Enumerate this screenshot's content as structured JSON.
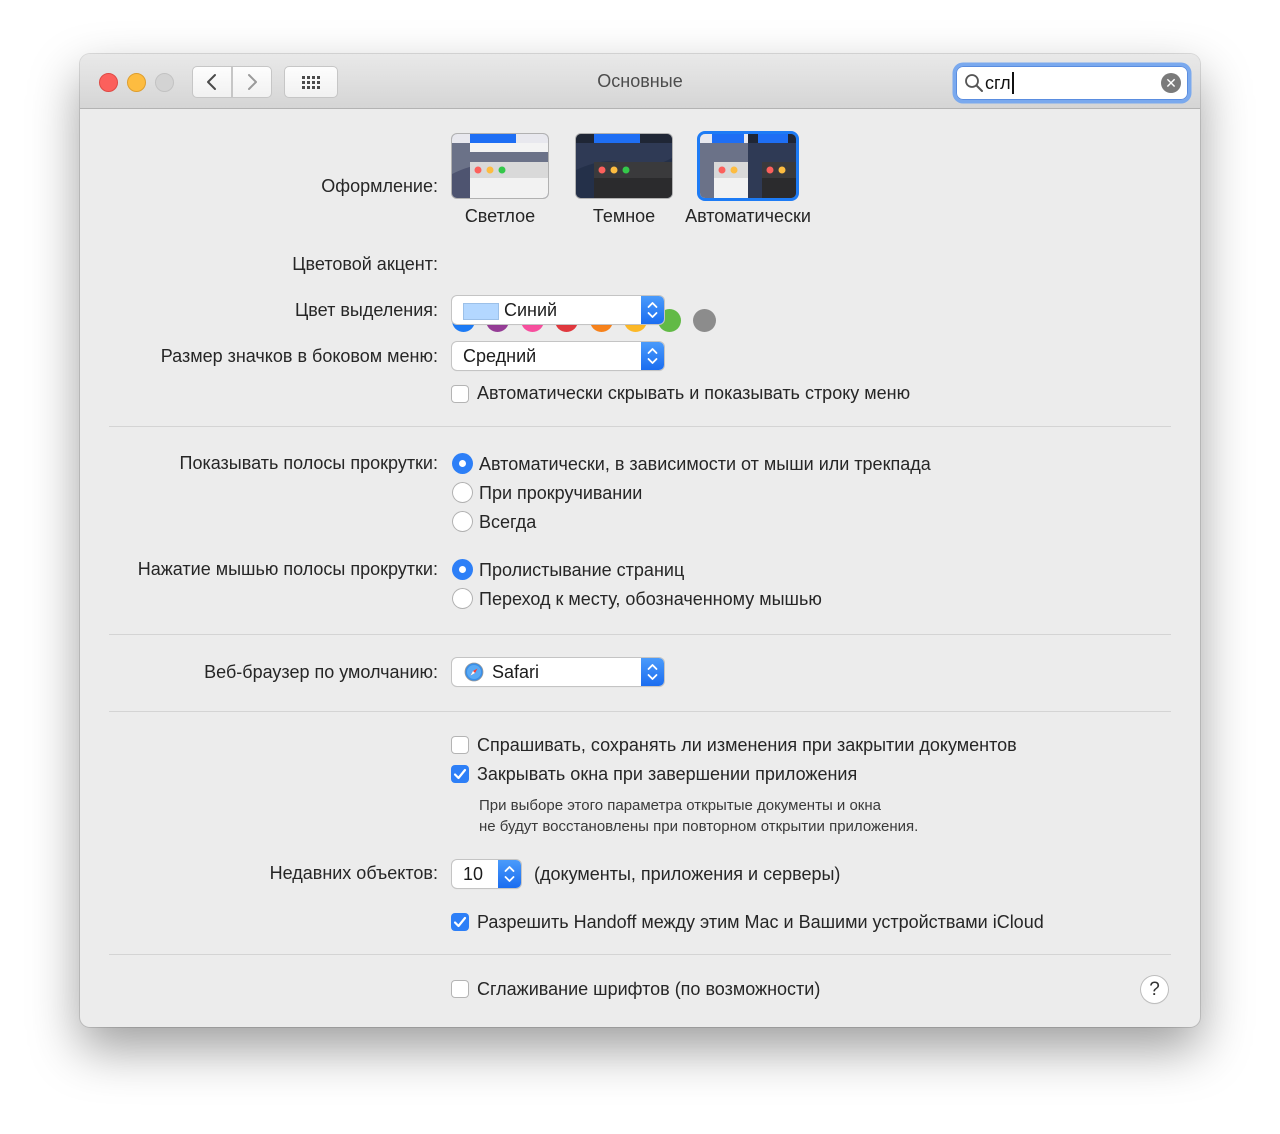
{
  "window": {
    "title": "Основные",
    "search": {
      "value": "сгл"
    },
    "traffic_lights": [
      "close",
      "minimize",
      "zoom-disabled"
    ],
    "nav_icons": [
      "chevron-left-icon",
      "chevron-right-icon",
      "grid-icon"
    ]
  },
  "appearance": {
    "label": "Оформление:",
    "options": [
      {
        "label": "Светлое",
        "selected": false
      },
      {
        "label": "Темное",
        "selected": false
      },
      {
        "label": "Автоматически",
        "selected": true
      }
    ]
  },
  "accent": {
    "label": "Цветовой акцент:",
    "colors": [
      "#1d7bf5",
      "#953d96",
      "#f74f9e",
      "#e0383e",
      "#f7821b",
      "#fcb827",
      "#62ba46",
      "#8c8c8c"
    ],
    "selected_index": 0
  },
  "highlight": {
    "label": "Цвет выделения:",
    "value": "Синий",
    "swatch_color": "#b3d7ff"
  },
  "sidebar_icons": {
    "label": "Размер значков в боковом меню:",
    "value": "Средний"
  },
  "autohide_menu": {
    "label": "Автоматически скрывать и показывать строку меню",
    "checked": false
  },
  "scrollbars": {
    "label": "Показывать полосы прокрутки:",
    "options": [
      {
        "label": "Автоматически, в зависимости от мыши или трекпада",
        "selected": true
      },
      {
        "label": "При прокручивании",
        "selected": false
      },
      {
        "label": "Всегда",
        "selected": false
      }
    ]
  },
  "scroll_click": {
    "label": "Нажатие мышью полосы прокрутки:",
    "options": [
      {
        "label": "Пролистывание страниц",
        "selected": true
      },
      {
        "label": "Переход к месту, обозначенному мышью",
        "selected": false
      }
    ]
  },
  "browser": {
    "label": "Веб-браузер по умолчанию:",
    "value": "Safari"
  },
  "ask_save": {
    "label": "Спрашивать, сохранять ли изменения при закрытии документов",
    "checked": false
  },
  "close_windows": {
    "label": "Закрывать окна при завершении приложения",
    "checked": true,
    "note_line1": "При выборе этого параметра открытые документы и окна",
    "note_line2": "не будут восстановлены при повторном открытии приложения."
  },
  "recent": {
    "label": "Недавних объектов:",
    "value": "10",
    "suffix": "(документы, приложения и серверы)"
  },
  "handoff": {
    "label": "Разрешить Handoff между этим Mac и Вашими устройствами iCloud",
    "checked": true
  },
  "font_smoothing": {
    "label": "Сглаживание шрифтов (по возможности)",
    "checked": false
  },
  "help": {
    "label": "?"
  },
  "colors": {
    "accent": "#2d7ff7",
    "window_bg": "#ececec"
  }
}
